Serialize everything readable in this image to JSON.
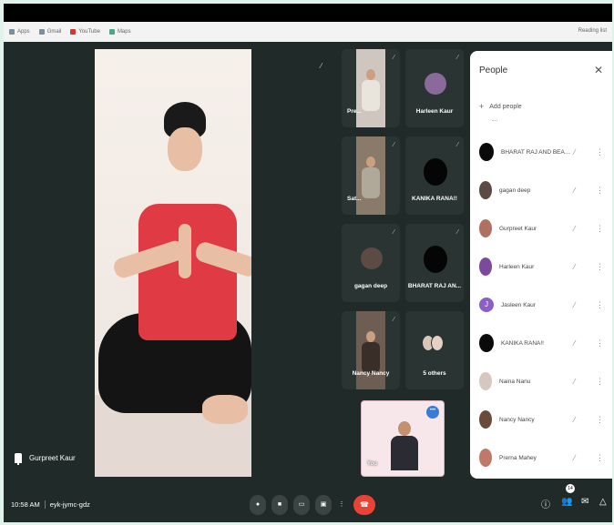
{
  "bookmarks": [
    {
      "label": "Apps",
      "icon": "apps-icon"
    },
    {
      "label": "Gmail",
      "icon": "gmail-icon"
    },
    {
      "label": "YouTube",
      "icon": "youtube-icon"
    },
    {
      "label": "Maps",
      "icon": "maps-icon"
    }
  ],
  "reading_list": "Reading list",
  "main": {
    "pinned_name": "Gurpreet Kaur"
  },
  "tiles": [
    {
      "label": "Pre...",
      "kind": "video"
    },
    {
      "label": "Harleen Kaur",
      "kind": "avatar"
    },
    {
      "label": "Sat...",
      "kind": "video"
    },
    {
      "label": "KANIKA RANA!!",
      "kind": "black"
    },
    {
      "label": "gagan deep",
      "kind": "avatar"
    },
    {
      "label": "BHARAT RAJ AN...",
      "kind": "black"
    },
    {
      "label": "Nancy Nancy",
      "kind": "video"
    },
    {
      "label": "5 others",
      "kind": "others"
    }
  ],
  "self_view": {
    "label": "You"
  },
  "people_panel": {
    "title": "People",
    "add_label": "Add people",
    "participants": [
      {
        "name": "BHARAT RAJ AND BEAUTI...",
        "avatar": "black"
      },
      {
        "name": "gagan deep",
        "avatar": "photo"
      },
      {
        "name": "Gurpreet Kaur",
        "avatar": "photo"
      },
      {
        "name": "Harleen Kaur",
        "avatar": "purple"
      },
      {
        "name": "Jasleen Kaur",
        "avatar": "letter",
        "initial": "J"
      },
      {
        "name": "KANIKA RANA!!",
        "avatar": "black"
      },
      {
        "name": "Naina Nanu",
        "avatar": "photo"
      },
      {
        "name": "Nancy Nancy",
        "avatar": "photo"
      },
      {
        "name": "Prerna Mahey",
        "avatar": "photo"
      }
    ]
  },
  "bottom": {
    "time": "10:58 AM",
    "meeting_code": "eyk-jymc-gdz",
    "people_count": "14"
  },
  "colors": {
    "background": "#1f2a29",
    "hangup": "#ea4335",
    "panel": "#ffffff"
  }
}
